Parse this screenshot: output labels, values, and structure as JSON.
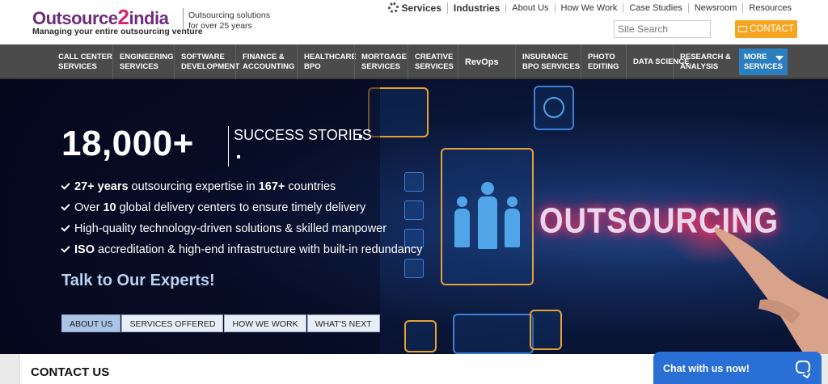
{
  "brand": {
    "name_part1": "Outsource",
    "name_two": "2",
    "name_part2": "india",
    "tagline": "Managing your entire outsourcing venture",
    "side_text": "Outsourcing solutions for over 25 years"
  },
  "topnav": {
    "items": [
      "Services",
      "Industries",
      "About Us",
      "How We Work",
      "Case Studies",
      "Newsroom",
      "Resources"
    ]
  },
  "search": {
    "placeholder": "Site Search"
  },
  "contact_button": "CONTACT",
  "mainnav": {
    "items": [
      "CALL CENTER SERVICES",
      "ENGINEERING SERVICES",
      "SOFTWARE DEVELOPMENT",
      "FINANCE & ACCOUNTING",
      "HEALTHCARE BPO",
      "MORTGAGE SERVICES",
      "CREATIVE SERVICES",
      "RevOps",
      "INSURANCE BPO SERVICES",
      "PHOTO EDITING",
      "DATA SCIENCE",
      "RESEARCH & ANALYSIS"
    ],
    "more": "MORE SERVICES"
  },
  "hero": {
    "big_number": "18,000+",
    "success_label": "SUCCESS STORIES",
    "bullets": [
      {
        "pre": "",
        "b1": "27+ years",
        "mid": " outsourcing expertise in ",
        "b2": "167+",
        "post": " countries"
      },
      {
        "pre": "Over ",
        "b1": "10",
        "mid": " global delivery centers to ensure timely delivery",
        "b2": "",
        "post": ""
      },
      {
        "pre": "High-quality technology-driven solutions & skilled manpower",
        "b1": "",
        "mid": "",
        "b2": "",
        "post": ""
      },
      {
        "pre": "",
        "b1": "ISO",
        "mid": " accreditation & high-end infrastructure with built-in redundancy",
        "b2": "",
        "post": ""
      }
    ],
    "talk": "Talk to Our Experts!",
    "art_word": "OUTSOURCING",
    "tabs": [
      "ABOUT US",
      "SERVICES OFFERED",
      "HOW WE WORK",
      "WHAT'S NEXT"
    ]
  },
  "contact_section": {
    "title": "CONTACT US"
  },
  "chat": {
    "label": "Chat with us now!"
  },
  "colors": {
    "accent_orange": "#f7a521",
    "nav_gray": "#4b4b4b",
    "more_blue": "#2b7fc0",
    "chat_blue": "#2a6fd6",
    "brand_purple": "#6b2d7a",
    "brand_pink": "#d6236e"
  }
}
